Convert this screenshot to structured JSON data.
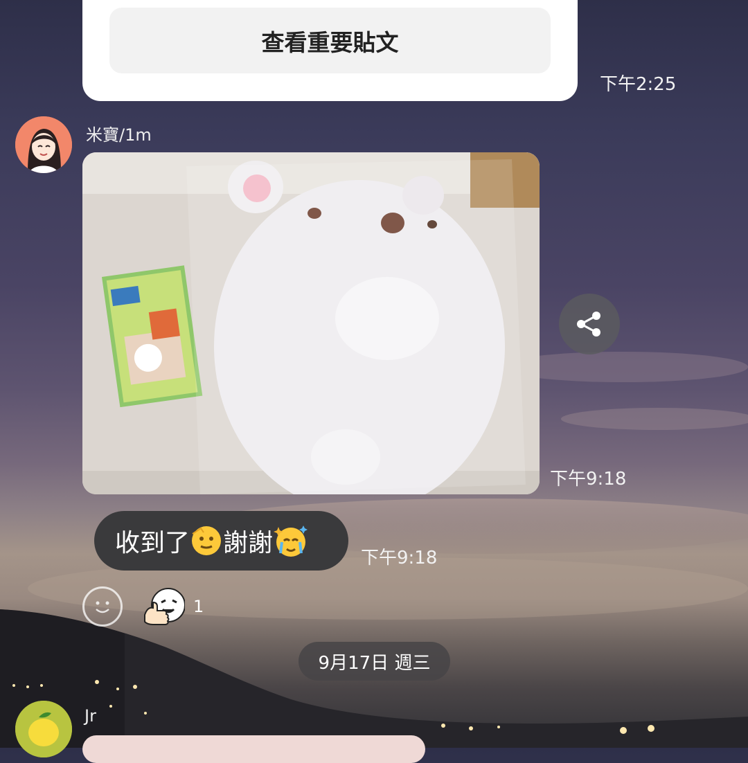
{
  "notice": {
    "button_label": "查看重要貼文",
    "time": "下午2:25"
  },
  "messages": [
    {
      "sender": "米寶/1m",
      "time_photo": "下午9:18",
      "text": "收到了",
      "text_after": "謝謝",
      "time_text": "下午9:18"
    },
    {
      "sender": "Jr"
    }
  ],
  "reactions": {
    "count": "1"
  },
  "date_separator": "9月17日 週三",
  "icons": {
    "share": "share-icon",
    "add_reaction": "smiley-icon",
    "reaction": "thumbs-up-character-icon"
  },
  "colors": {
    "bubble": "#3a3a3c",
    "card": "#ffffff",
    "button_bg": "#f2f2f2"
  }
}
